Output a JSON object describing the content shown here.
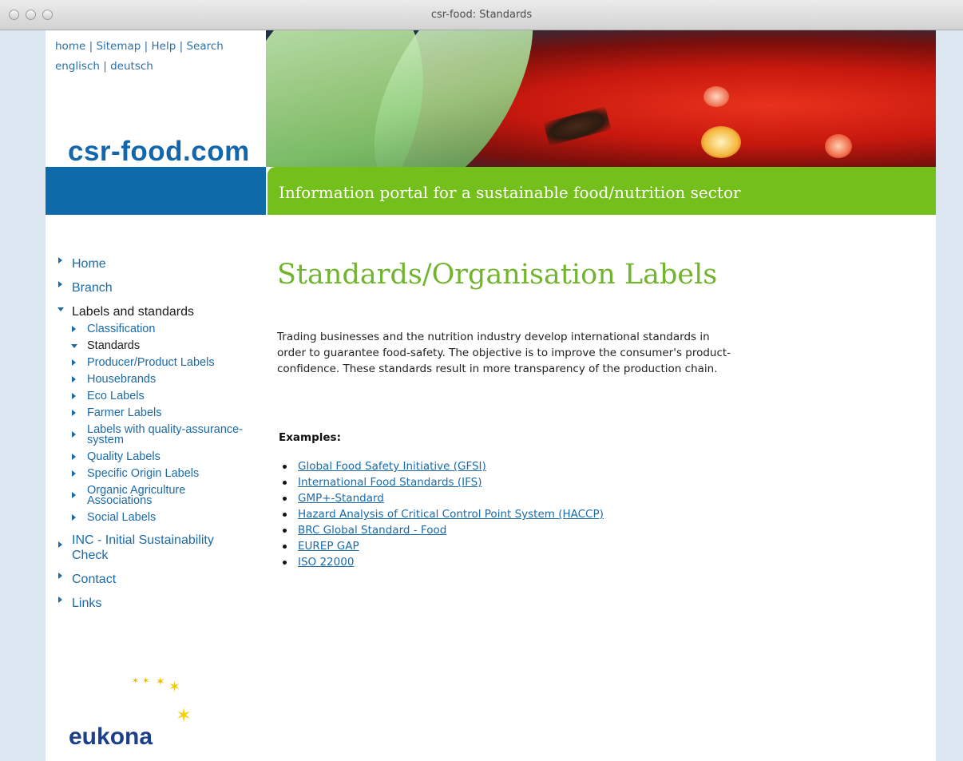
{
  "window": {
    "title": "csr-food: Standards"
  },
  "header": {
    "top_links": [
      "home",
      "Sitemap",
      "Help",
      "Search"
    ],
    "lang_links": [
      "englisch",
      "deutsch"
    ],
    "logo": "csr-food.com",
    "tagline": "Information portal for a sustainable food/nutrition sector"
  },
  "nav": {
    "items": [
      {
        "label": "Home"
      },
      {
        "label": "Branch"
      },
      {
        "label": "Labels and standards"
      }
    ],
    "sub_items": [
      {
        "label": "Classification"
      },
      {
        "label": "Standards"
      },
      {
        "label": "Producer/Product Labels"
      },
      {
        "label": "Housebrands"
      },
      {
        "label": "Eco Labels"
      },
      {
        "label": "Farmer Labels"
      },
      {
        "label_line1": "Labels with quality-assurance-",
        "label_line2": "system"
      },
      {
        "label": "Quality Labels"
      },
      {
        "label": "Specific Origin Labels"
      },
      {
        "label_line1": "Organic Agriculture",
        "label_line2": "Associations"
      },
      {
        "label": "Social Labels"
      }
    ],
    "bottom_items": [
      {
        "label_line1": "INC - Initial Sustainability",
        "label_line2": "Check"
      },
      {
        "label": "Contact"
      },
      {
        "label": "Links"
      }
    ]
  },
  "main": {
    "title": "Standards/Organisation Labels",
    "intro": "Trading businesses and the nutrition industry develop international standards in order to guarantee food-safety. The objective is to improve the consumer's product-confidence. These standards result in more transparency of the production chain.",
    "examples_heading": "Examples:",
    "examples": [
      "Global Food Safety Initiative (GFSI)",
      "International Food Standards (IFS)",
      "GMP+-Standard",
      "Hazard Analysis of Critical Control Point System (HACCP)",
      "BRC Global Standard - Food",
      "EUREP GAP",
      "ISO 22000"
    ]
  },
  "footer": {
    "logo": "eukona"
  },
  "colors": {
    "link": "#1b6aa8",
    "green": "#74bf1b",
    "blue": "#0e6aa8",
    "title_green": "#70b52b",
    "page_bg": "#dbe6f1"
  }
}
